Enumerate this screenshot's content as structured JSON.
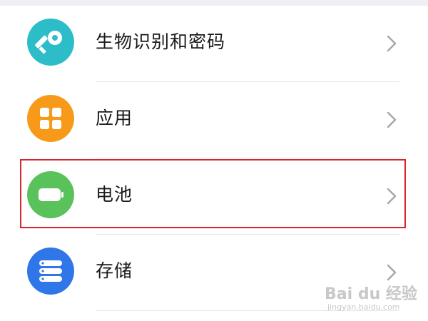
{
  "settings": {
    "items": [
      {
        "label": "生物识别和密码",
        "icon": "key-icon",
        "color": "#2dbdc9"
      },
      {
        "label": "应用",
        "icon": "apps-grid-icon",
        "color": "#f79a1a"
      },
      {
        "label": "电池",
        "icon": "battery-icon",
        "color": "#5ac25a"
      },
      {
        "label": "存储",
        "icon": "storage-icon",
        "color": "#2f76e8"
      }
    ],
    "highlighted_item": "电池"
  },
  "watermark": {
    "main": "Bai du 经验",
    "sub": "jingyan.baidu.com"
  },
  "colors": {
    "highlight": "#d6252d",
    "chevron": "#a6a6a6",
    "divider": "#e6e6e6"
  }
}
